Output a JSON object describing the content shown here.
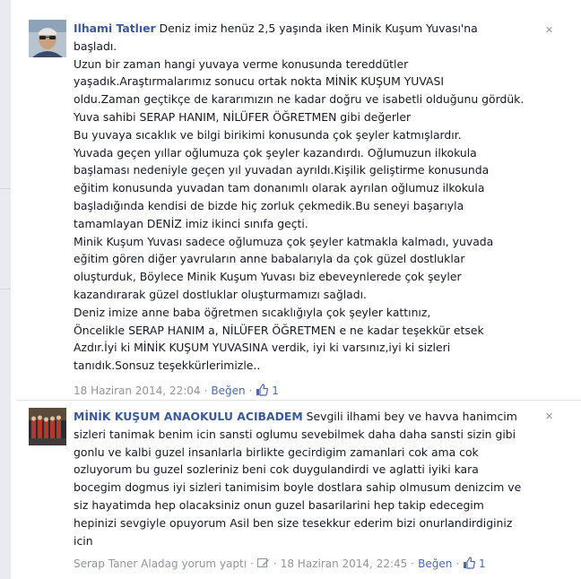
{
  "comments": [
    {
      "author": "Ilhami Tatlıer",
      "text": "Deniz imiz henüz 2,5 yaşında iken Minik Kuşum Yuvası'na\nbaşladı.\nUzun bir zaman hangi yuvaya verme konusunda tereddütler\nyaşadık.Araştırmalarımız sonucu ortak nokta MİNİK KUŞUM YUVASI\noldu.Zaman geçtikçe de kararımızın ne kadar doğru ve isabetli olduğunu gördük.\nYuva sahibi SERAP HANIM, NİLÜFER ÖĞRETMEN gibi değerler\nBu yuvaya sıcaklık ve bilgi birikimi konusunda çok şeyler katmışlardır.\nYuvada geçen yıllar oğlumuza çok şeyler kazandırdı. Oğlumuzun ilkokula\nbaşlaması nedeniyle geçen yıl yuvadan ayrıldı.Kişilik geliştirme konusunda\neğitim konusunda yuvadan tam donanımlı olarak ayrılan oğlumuz ilkokula\nbaşladığında kendisi de bizde hiç zorluk çekmedik.Bu seneyi başarıyla\ntamamlayan DENİZ imiz ikinci sınıfa geçti.\nMinik Kuşum Yuvası sadece oğlumuza çok şeyler katmakla kalmadı, yuvada\neğitim gören diğer yavruların anne babalarıyla da çok güzel dostluklar\noluşturduk, Böylece Minik Kuşum Yuvası biz ebeveynlerede çok şeyler\nkazandırarak güzel dostluklar oluşturmamızı sağladı.\nDeniz imize anne baba öğretmen sıcaklığıyla çok şeyler kattınız,\nÖncelikle SERAP HANIM a, NİLÜFER ÖĞRETMEN e ne kadar teşekkür etsek\nAzdır.İyi ki MİNİK KUŞUM YUVASINA verdik, iyi ki varsınız,iyi ki sizleri\ntanıdık.Sonsuz teşekkürlerimizle..",
      "date": "18 Haziran 2014, 22:04",
      "like_label": "Beğen",
      "like_count": "1",
      "close": "✕"
    },
    {
      "author": "MİNİK KUŞUM ANAOKULU ACIBADEM",
      "text": "Sevgili ilhami bey ve havva hanimcim\nsizleri tanimak benim icin sansti oglumu sevebilmek daha daha sansti sizin gibi\ngonlu ve kalbi guzel insanlarla birlikte gecirdigim zamanlari cok ama cok\nozluyorum bu guzel sozleriniz beni cok duygulandirdi ve aglatti iyiki kara\nbocegim dogmus iyi sizleri tanimisim boyle dostlara sahip olmusum denizcim ve\nsiz hayatimda hep olacaksiniz onun guzel basarilarini hep takip edecegim\nhepinizi sevgiyle opuyorum Asil ben size tesekkur ederim bizi onurlandirdiginiz\nicin",
      "posted_by": "Serap Taner Aladag yorum yaptı",
      "date": "18 Haziran 2014, 22:45",
      "like_label": "Beğen",
      "like_count": "1",
      "close": "✕"
    }
  ],
  "colors": {
    "author": "#3b5998",
    "link": "#4e69a2",
    "meta": "#90949c",
    "text": "#141823"
  }
}
